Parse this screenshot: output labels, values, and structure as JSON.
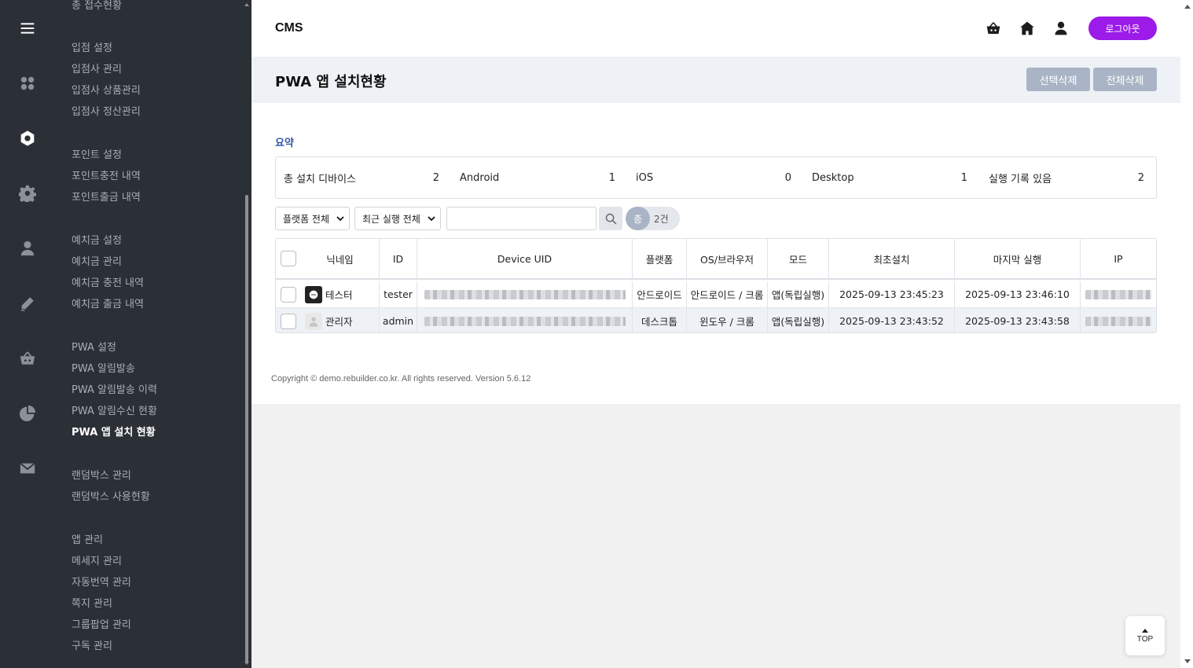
{
  "header": {
    "brand": "CMS",
    "logout_label": "로그아웃",
    "icons": [
      "basket-icon",
      "home-icon",
      "user-icon"
    ]
  },
  "rail": {
    "icons": [
      "menu-icon",
      "apps-icon",
      "circle-dot-icon",
      "gear-icon",
      "person-icon",
      "pencil-icon",
      "basket-icon",
      "pie-chart-icon",
      "mail-icon"
    ],
    "active": "circle-dot-icon"
  },
  "menu": {
    "items": [
      "총 접수현황",
      "입점 설정",
      "입점사 관리",
      "입점사 상품관리",
      "입점사 정산관리",
      "포인트 설정",
      "포인트충전 내역",
      "포인트출금 내역",
      "예치금 설정",
      "예치금 관리",
      "예치금 충전 내역",
      "예치금 출금 내역",
      "PWA 설정",
      "PWA 알림발송",
      "PWA 알림발송 이력",
      "PWA 알림수신 현황",
      "PWA 앱 설치 현황",
      "랜덤박스 관리",
      "랜덤박스 사용현황",
      "앱 관리",
      "메세지 관리",
      "자동번역 관리",
      "쪽지 관리",
      "그룹팝업 관리",
      "구독 관리"
    ],
    "active": "PWA 앱 설치 현황"
  },
  "page": {
    "title": "PWA 앱 설치현황",
    "delete_selected": "선택삭제",
    "delete_all": "전체삭제"
  },
  "summary": {
    "label": "요약",
    "items": [
      {
        "label": "총 설치 디바이스",
        "value": "2"
      },
      {
        "label": "Android",
        "value": "1"
      },
      {
        "label": "iOS",
        "value": "0"
      },
      {
        "label": "Desktop",
        "value": "1"
      },
      {
        "label": "실행 기록 있음",
        "value": "2"
      }
    ]
  },
  "filters": {
    "platform": "플랫폼 전체",
    "recent": "최근 실행 전체",
    "search_value": "",
    "count_prefix": "총",
    "count_text": "2건"
  },
  "table": {
    "columns": [
      "",
      "닉네임",
      "ID",
      "Device UID",
      "플랫폼",
      "OS/브라우저",
      "모드",
      "최초설치",
      "마지막 실행",
      "IP"
    ],
    "rows": [
      {
        "nickname": "테스터",
        "id": "tester",
        "platform": "안드로이드",
        "os": "안드로이드 / 크롬",
        "mode": "앱(독립실행)",
        "first_install": "2025-09-13 23:45:23",
        "last_run": "2025-09-13 23:46:10"
      },
      {
        "nickname": "관리자",
        "id": "admin",
        "platform": "데스크톱",
        "os": "윈도우 / 크롬",
        "mode": "앱(독립실행)",
        "first_install": "2025-09-13 23:43:52",
        "last_run": "2025-09-13 23:43:58"
      }
    ]
  },
  "footer": "Copyright © demo.rebuilder.co.kr. All rights reserved. Version 5.6.12",
  "top_button": "TOP",
  "colors": {
    "sidebar": "#2b2f36",
    "accent": "#9c1be8",
    "muted_button": "#a9b5c6",
    "link": "#3455a8"
  }
}
